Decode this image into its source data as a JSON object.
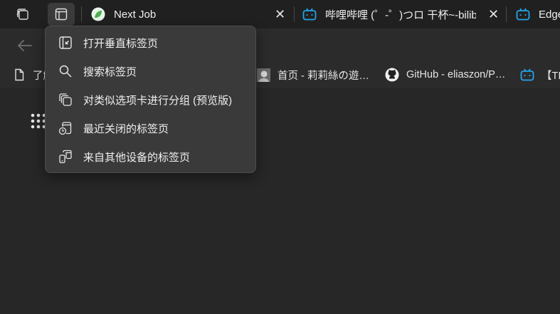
{
  "tabs": [
    {
      "title": "Next Job",
      "favicon": "green-circle-icon"
    },
    {
      "title": "哔哩哔哩 (゜-゜)つロ 干杯~-bilibili",
      "favicon": "bilibili-icon"
    },
    {
      "title": "Edge",
      "favicon": "bilibili-icon"
    }
  ],
  "tab_close_glyph": "✕",
  "bookmarks": [
    {
      "label": "了解",
      "icon": "page-icon"
    },
    {
      "label": "首页 - 莉莉絲の遊…",
      "icon": "avatar-icon"
    },
    {
      "label": "GitHub - eliaszon/P…",
      "icon": "github-icon"
    },
    {
      "label": "【TI",
      "icon": "bilibili-icon"
    }
  ],
  "menu": {
    "items": [
      {
        "label": "打开垂直标签页",
        "icon": "vertical-tabs-icon"
      },
      {
        "label": "搜索标签页",
        "icon": "search-icon"
      },
      {
        "label": "对类似选项卡进行分组 (预览版)",
        "icon": "group-tabs-icon"
      },
      {
        "label": "最近关闭的标签页",
        "icon": "recently-closed-icon"
      },
      {
        "label": "来自其他设备的标签页",
        "icon": "other-devices-icon"
      }
    ]
  },
  "colors": {
    "tabstrip_bg": "#202020",
    "toolbar_bg": "#2b2b2b",
    "menu_bg": "#3a3a3a",
    "bilibili_blue": "#23a5e8",
    "favicon_green": "#4caf50"
  }
}
